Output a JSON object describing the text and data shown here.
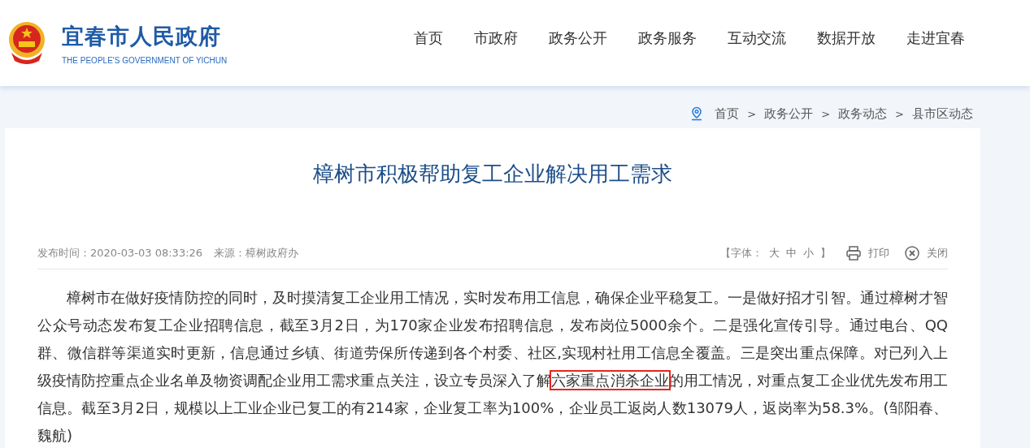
{
  "header": {
    "site_name": "宜春市人民政府",
    "site_subtitle": "THE PEOPLE'S GOVERNMENT OF YICHUN",
    "nav": [
      "首页",
      "市政府",
      "政务公开",
      "政务服务",
      "互动交流",
      "数据开放",
      "走进宜春"
    ]
  },
  "breadcrumb": [
    {
      "label": "首页"
    },
    {
      "label": "政务公开"
    },
    {
      "label": "政务动态"
    },
    {
      "label": "县市区动态"
    }
  ],
  "breadcrumb_separator": ">",
  "article": {
    "title": "樟树市积极帮助复工企业解决用工需求",
    "publish_time": "发布时间：2020-03-03 08:33:26",
    "source": "来源：樟树政府办",
    "font_size_open": "【字体：",
    "font_sizes": [
      "大",
      "中",
      "小"
    ],
    "font_size_close": "】",
    "print": "打印",
    "close": "关闭",
    "body": {
      "before": "樟树市在做好疫情防控的同时，及时摸清复工企业用工情况，实时发布用工信息，确保企业平稳复工。一是做好招才引智。通过樟树才智公众号动态发布复工企业招聘信息，截至3月2日，为170家企业发布招聘信息，发布岗位5000余个。二是强化宣传引导。通过电台、QQ群、微信群等渠道实时更新，信息通过乡镇、街道劳保所传递到各个村委、社区,实现村社用工信息全覆盖。三是突出重点保障。对已列入上级疫情防控重点企业名单及物资调配企业用工需求重点关注，设立专员深入了解",
      "highlighted": "六家重点消杀企业",
      "after": "的用工情况，对重点复工企业优先发布用工信息。截至3月2日，规模以上工业企业已复工的有214家，企业复工率为100%，企业员工返岗人数13079人，返岗率为58.3%。(邹阳春、魏航)"
    }
  }
}
